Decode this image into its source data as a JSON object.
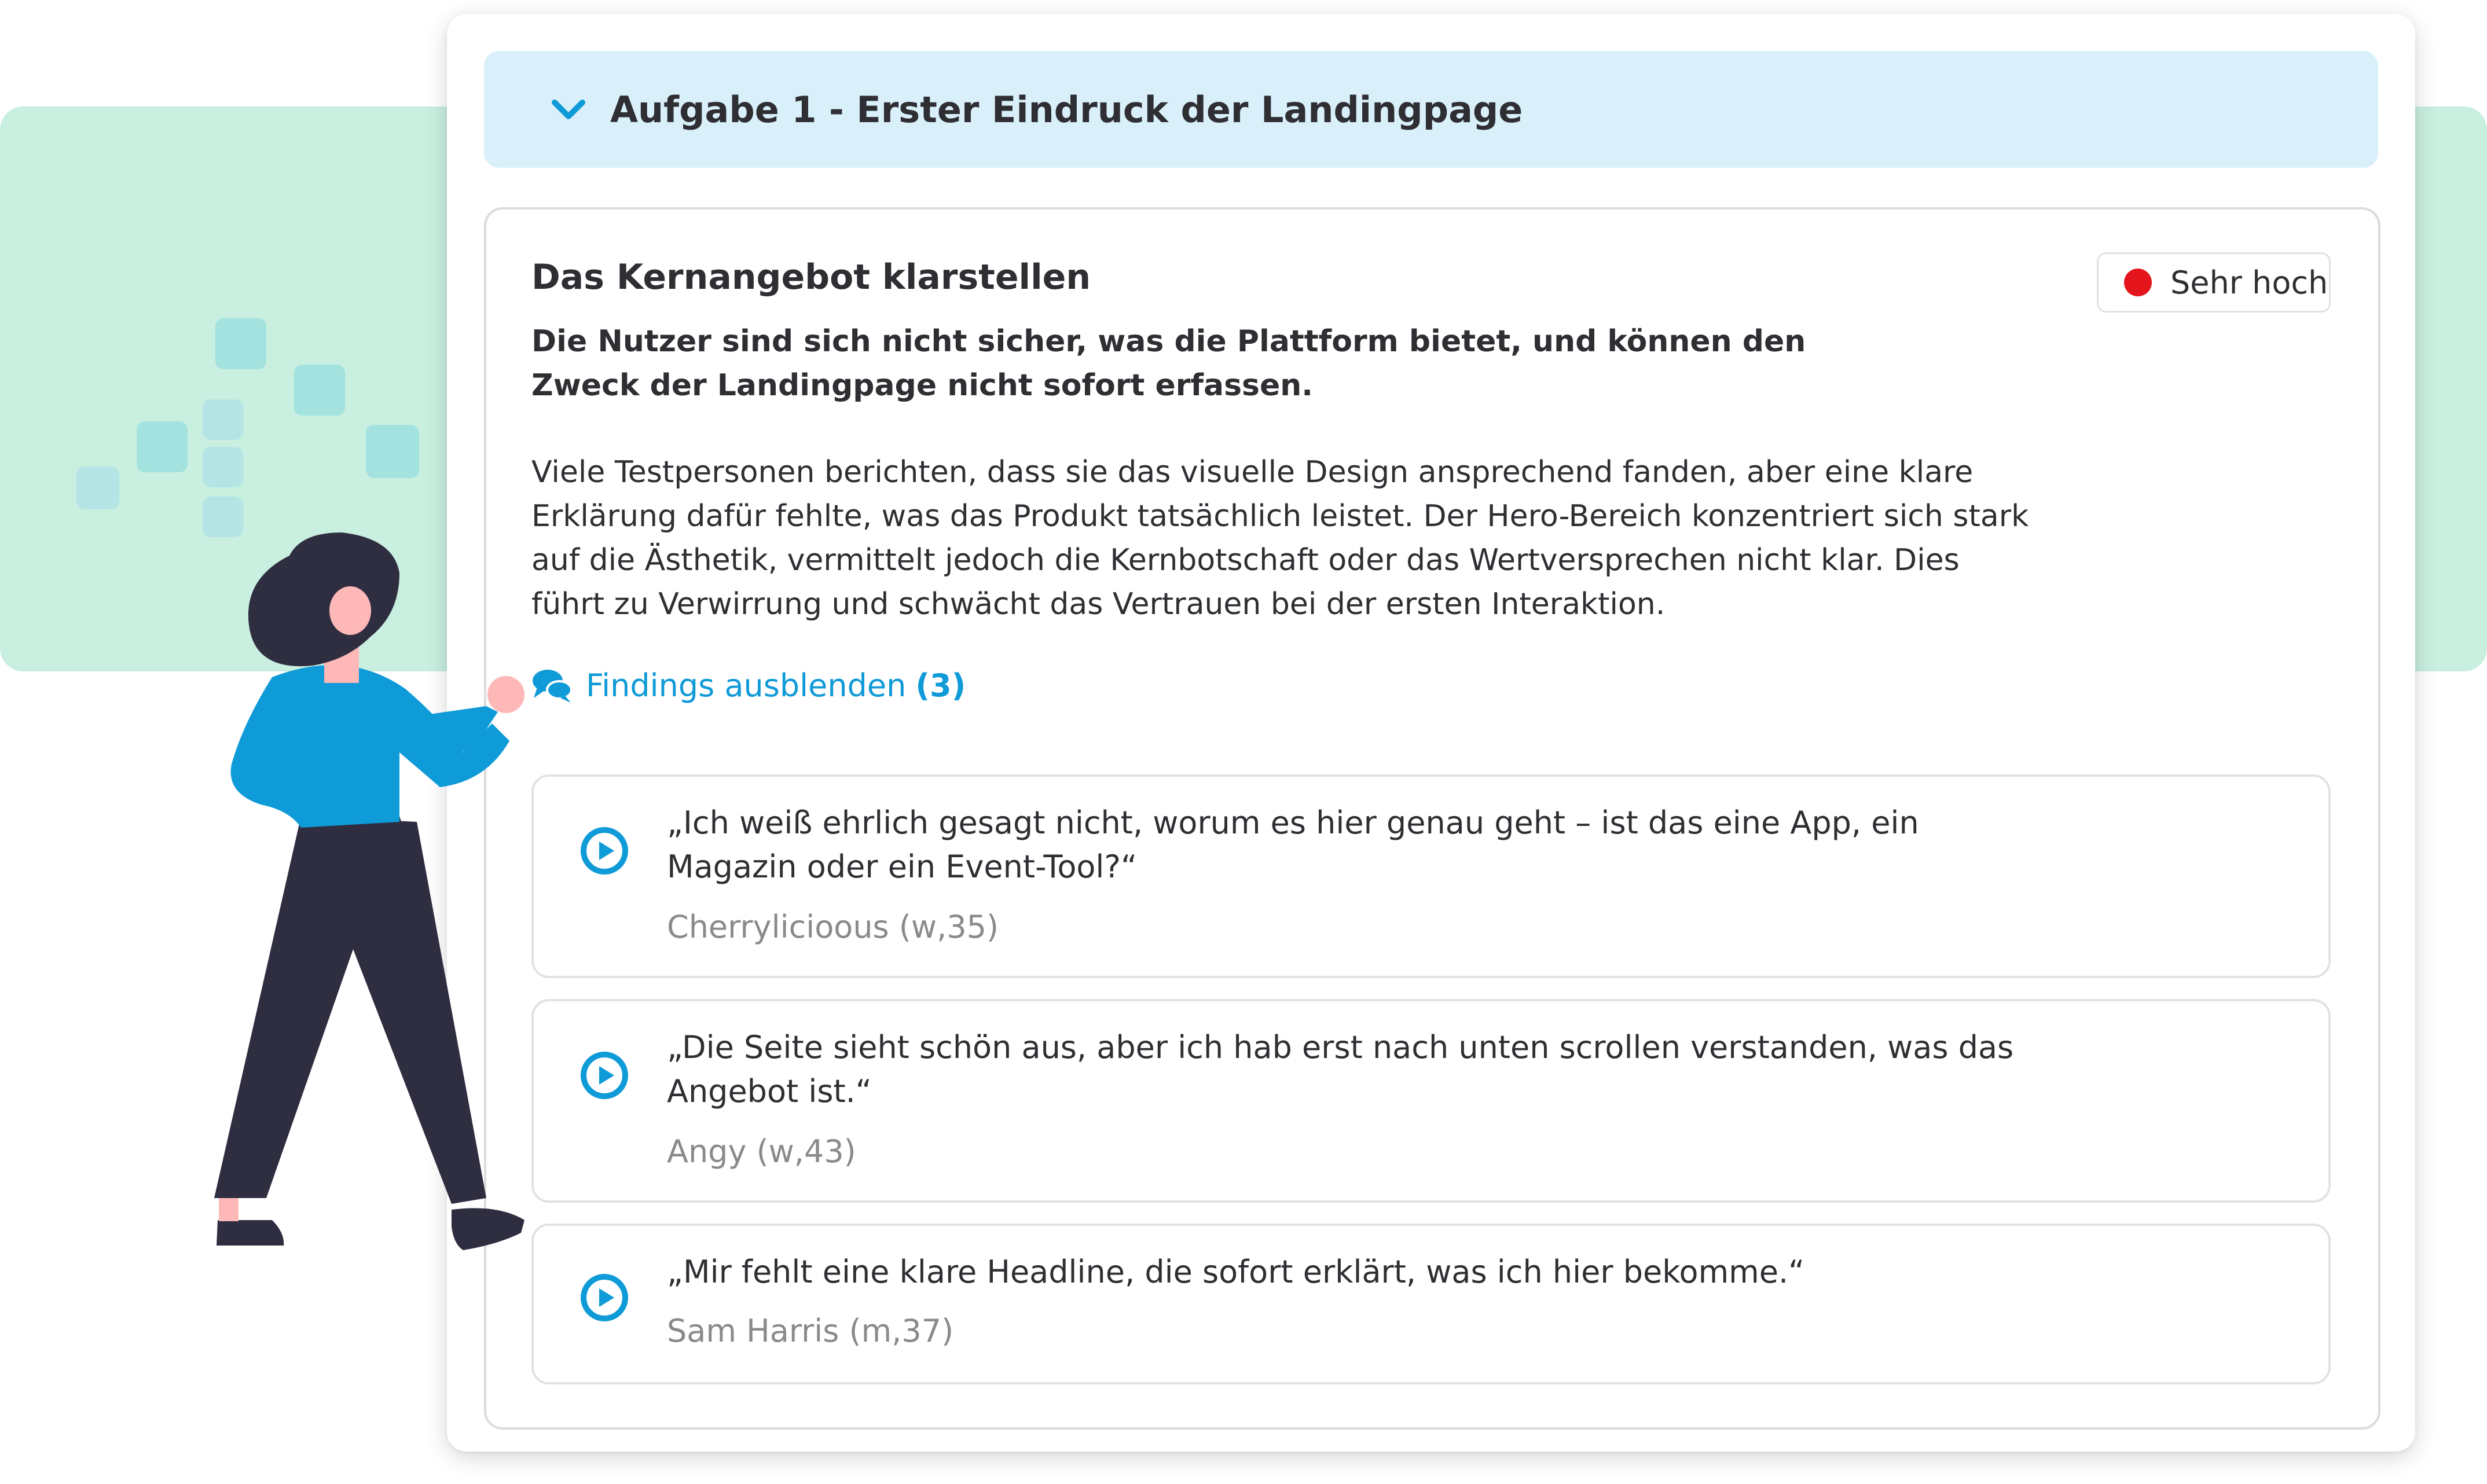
{
  "task": {
    "title": "Aufgabe 1 - Erster Eindruck der Landingpage",
    "chevron_icon": "chevron-down-icon"
  },
  "finding": {
    "title": "Das Kernangebot klarstellen",
    "severity": {
      "label": "Sehr hoch",
      "color": "#e3141b"
    },
    "summary": "Die Nutzer sind sich nicht sicher, was die Plattform bietet, und können den Zweck der Landingpage nicht sofort erfassen.",
    "description": "Viele Testpersonen berichten, dass sie das visuelle Design ansprechend fanden, aber eine klare Erklärung dafür fehlte, was das Produkt tatsächlich leistet. Der Hero-Bereich konzentriert sich stark auf die Ästhetik, vermittelt jedoch die Kernbotschaft oder das Wertversprechen nicht klar. Dies führt zu Verwirrung und schwächt das Vertrauen bei der ersten Interaktion.",
    "toggle": {
      "label": "Findings ausblenden",
      "count": "(3)",
      "icon": "comments-icon"
    },
    "quotes": [
      {
        "text": "„Ich weiß ehrlich gesagt nicht, worum es hier genau geht – ist das eine App, ein Magazin oder ein Event-Tool?“",
        "author": "Cherrylicioous (w,35)"
      },
      {
        "text": "„Die Seite sieht schön aus, aber ich hab erst nach unten scrollen verstanden, was das Angebot ist.“",
        "author": "Angy (w,43)"
      },
      {
        "text": "„Mir fehlt eine klare Headline, die sofort erklärt, was ich hier bekomme.“",
        "author": "Sam Harris (m,37)"
      }
    ]
  },
  "colors": {
    "accent": "#0f9ad8",
    "header_bg": "#d9f0fa",
    "background_band": "#c9efe0",
    "severity_high": "#e3141b"
  }
}
